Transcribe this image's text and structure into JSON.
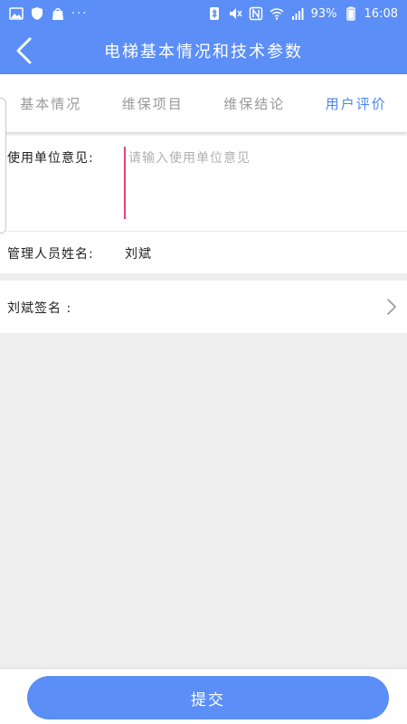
{
  "status_bar": {
    "dots": "···",
    "battery": "93%",
    "time": "16:08",
    "left_icons": [
      "gallery-icon",
      "shield-icon",
      "bag-icon"
    ],
    "right_icons": [
      "bluetooth-icon",
      "mute-icon",
      "nfc-icon",
      "wifi-icon",
      "signal-icon",
      "battery-icon"
    ]
  },
  "header": {
    "title": "电梯基本情况和技术参数",
    "back_icon": "back-arrow-icon",
    "bar_color": "#5b8ef6"
  },
  "tabs": [
    {
      "label": "基本情况",
      "active": false
    },
    {
      "label": "维保项目",
      "active": false
    },
    {
      "label": "维保结论",
      "active": false
    },
    {
      "label": "用户评价",
      "active": true
    }
  ],
  "form": {
    "opinion_label": "使用单位意见:",
    "opinion_placeholder": "请输入使用单位意见",
    "opinion_value": "",
    "manager_label": "管理人员姓名:",
    "manager_value": "刘斌",
    "sign_label": "刘斌签名 :"
  },
  "submit": {
    "label": "提交",
    "color": "#5b8ef6"
  },
  "colors": {
    "accent": "#5b8ef6",
    "active_tab": "#4d86ec",
    "cursor": "#e0457a"
  }
}
